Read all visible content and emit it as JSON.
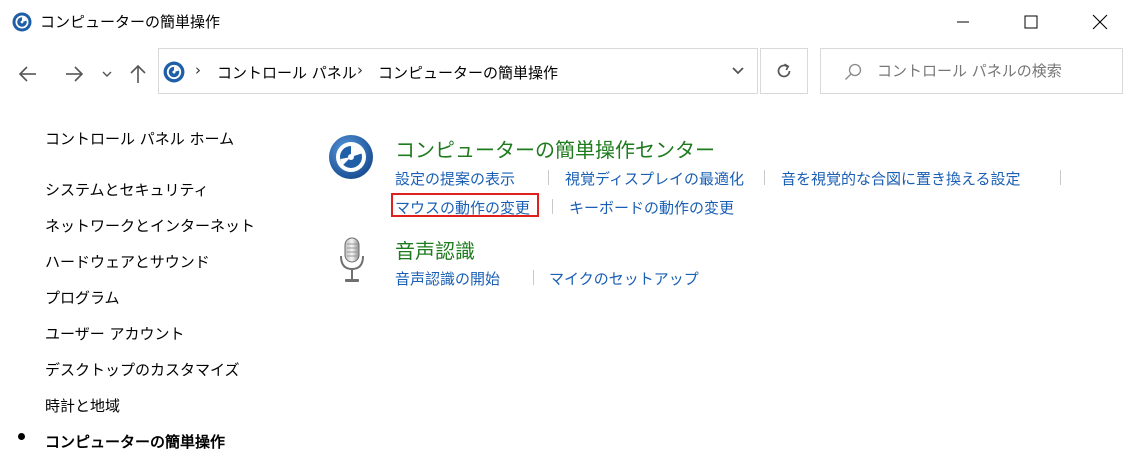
{
  "window": {
    "title": "コンピューターの簡単操作"
  },
  "address_bar": {
    "breadcrumbs": [
      "コントロール パネル",
      "コンピューターの簡単操作"
    ]
  },
  "search": {
    "placeholder": "コントロール パネルの検索"
  },
  "sidebar": {
    "home": "コントロール パネル ホーム",
    "items": [
      {
        "label": "システムとセキュリティ"
      },
      {
        "label": "ネットワークとインターネット"
      },
      {
        "label": "ハードウェアとサウンド"
      },
      {
        "label": "プログラム"
      },
      {
        "label": "ユーザー アカウント"
      },
      {
        "label": "デスクトップのカスタマイズ"
      },
      {
        "label": "時計と地域"
      },
      {
        "label": "コンピューターの簡単操作",
        "selected": true
      }
    ]
  },
  "main": {
    "categories": [
      {
        "title": "コンピューターの簡単操作センター",
        "icon": "ease-of-access-icon",
        "links": [
          "設定の提案の表示",
          "視覚ディスプレイの最適化",
          "音を視覚的な合図に置き換える設定",
          "マウスの動作の変更",
          "キーボードの動作の変更"
        ]
      },
      {
        "title": "音声認識",
        "icon": "microphone-icon",
        "links": [
          "音声認識の開始",
          "マイクのセットアップ"
        ]
      }
    ]
  },
  "colors": {
    "category_title": "#1e7b1e",
    "link": "#1a5fb4",
    "highlight": "#e0201c"
  }
}
